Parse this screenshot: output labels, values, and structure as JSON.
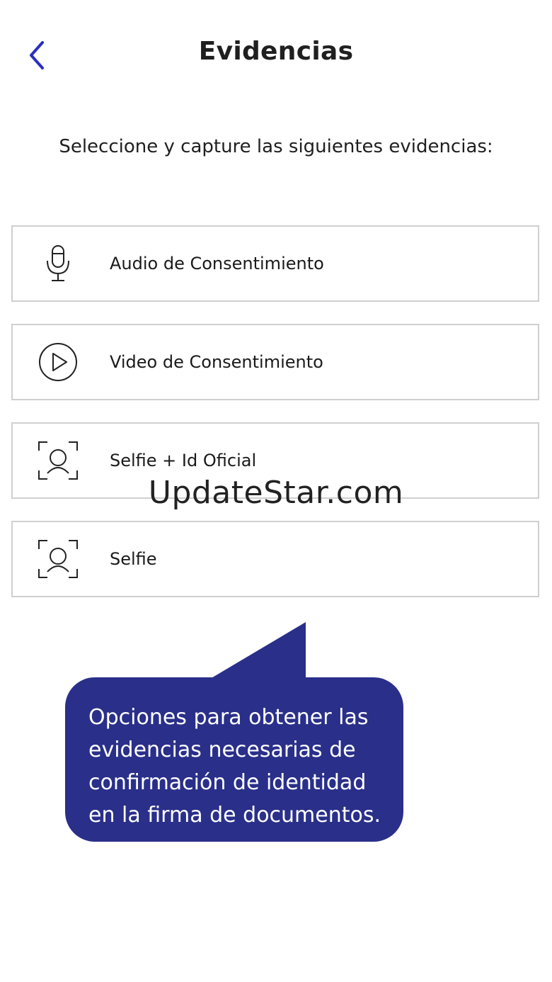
{
  "header": {
    "title": "Evidencias",
    "back_icon": "chevron-left-icon",
    "accent_color": "#2a2fbf"
  },
  "instructions": "Seleccione y capture las siguientes evidencias:",
  "options": [
    {
      "label": "Audio de Consentimiento",
      "icon": "microphone-icon"
    },
    {
      "label": "Video de Consentimiento",
      "icon": "play-circle-icon"
    },
    {
      "label": "Selfie + Id Oficial",
      "icon": "face-scan-icon"
    },
    {
      "label": "Selfie",
      "icon": "face-scan-icon"
    }
  ],
  "watermark": "UpdateStar.com",
  "tooltip": {
    "text": "Opciones para obtener las evidencias necesarias de confirmación de identidad en la firma de documentos.",
    "background": "#2a2f8a"
  }
}
